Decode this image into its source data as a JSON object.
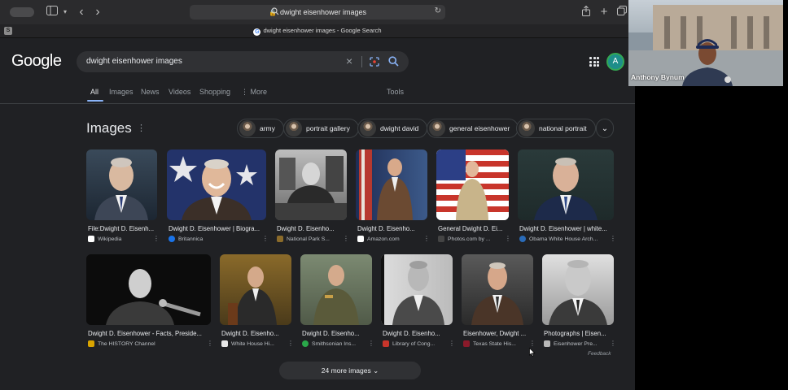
{
  "browser": {
    "url": "dwight eisenhower images",
    "tab_title": "dwight eisenhower images - Google Search",
    "tab_favicon_left": "S"
  },
  "google": {
    "logo": "Google",
    "query": "dwight eisenhower images",
    "avatar_letter": "A",
    "nav": {
      "all": "All",
      "images": "Images",
      "news": "News",
      "videos": "Videos",
      "shopping": "Shopping",
      "more": "More",
      "tools": "Tools"
    },
    "section_title": "Images",
    "chips": [
      {
        "label": "army"
      },
      {
        "label": "portrait gallery"
      },
      {
        "label": "dwight david"
      },
      {
        "label": "general eisenhower"
      },
      {
        "label": "national portrait"
      }
    ],
    "row1": [
      {
        "title": "File:Dwight D. Eisenh...",
        "source": "Wikipedia"
      },
      {
        "title": "Dwight D. Eisenhower | Biogra...",
        "source": "Britannica"
      },
      {
        "title": "Dwight D. Eisenho...",
        "source": "National Park S..."
      },
      {
        "title": "Dwight D. Eisenho...",
        "source": "Amazon.com"
      },
      {
        "title": "General Dwight D. Ei...",
        "source": "Photos.com by ..."
      },
      {
        "title": "Dwight D. Eisenhower | white...",
        "source": "Obama White House Arch..."
      }
    ],
    "row2": [
      {
        "title": "Dwight D. Eisenhower - Facts, Preside...",
        "source": "The HISTORY Channel"
      },
      {
        "title": "Dwight D. Eisenho...",
        "source": "White House Hi..."
      },
      {
        "title": "Dwight D. Eisenho...",
        "source": "Smithsonian Ins..."
      },
      {
        "title": "Dwight D. Eisenho...",
        "source": "Library of Cong..."
      },
      {
        "title": "Eisenhower, Dwight ...",
        "source": "Texas State His..."
      },
      {
        "title": "Photographs | Eisen...",
        "source": "Eisenhower Pre..."
      }
    ],
    "feedback": "Feedback",
    "more_images": "24 more images"
  },
  "webcam": {
    "participant_name": "Anthony Bynum"
  },
  "colors": {
    "page_bg": "#202124",
    "accent_blue": "#8ab4f8",
    "avatar_ring": "#34a853"
  }
}
